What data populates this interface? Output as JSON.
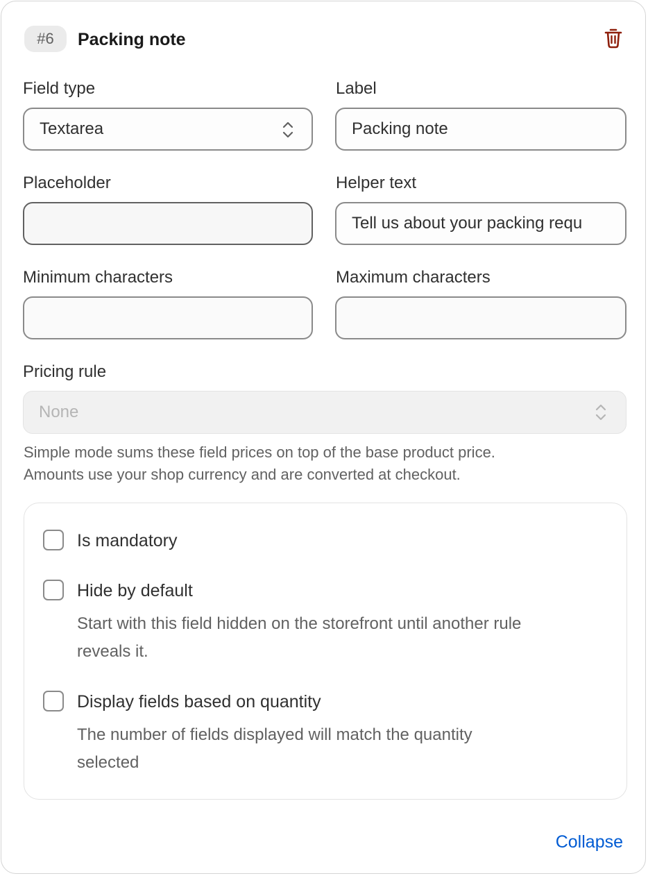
{
  "header": {
    "badge": "#6",
    "title": "Packing note"
  },
  "fields": {
    "field_type": {
      "label": "Field type",
      "value": "Textarea"
    },
    "label": {
      "label": "Label",
      "value": "Packing note"
    },
    "placeholder": {
      "label": "Placeholder",
      "value": ""
    },
    "helper_text": {
      "label": "Helper text",
      "value": "Tell us about your packing requ"
    },
    "min_chars": {
      "label": "Minimum characters",
      "value": ""
    },
    "max_chars": {
      "label": "Maximum characters",
      "value": ""
    },
    "pricing_rule": {
      "label": "Pricing rule",
      "value": "None",
      "help_line1": "Simple mode sums these field prices on top of the base product price.",
      "help_line2": "Amounts use your shop currency and are converted at checkout."
    }
  },
  "options": {
    "mandatory": {
      "label": "Is mandatory",
      "checked": false
    },
    "hide_default": {
      "label": "Hide by default",
      "desc_line1": "Start with this field hidden on the storefront until another rule",
      "desc_line2": "reveals it.",
      "checked": false
    },
    "quantity": {
      "label": "Display fields based on quantity",
      "desc_line1": "The number of fields displayed will match the quantity",
      "desc_line2": "selected",
      "checked": false
    }
  },
  "footer": {
    "collapse_label": "Collapse"
  },
  "colors": {
    "accent": "#005bd3",
    "delete": "#8e1f0b",
    "border": "#8a8a8a"
  },
  "icons": {
    "delete": "trash-icon",
    "select": "chevron-up-down-icon"
  }
}
